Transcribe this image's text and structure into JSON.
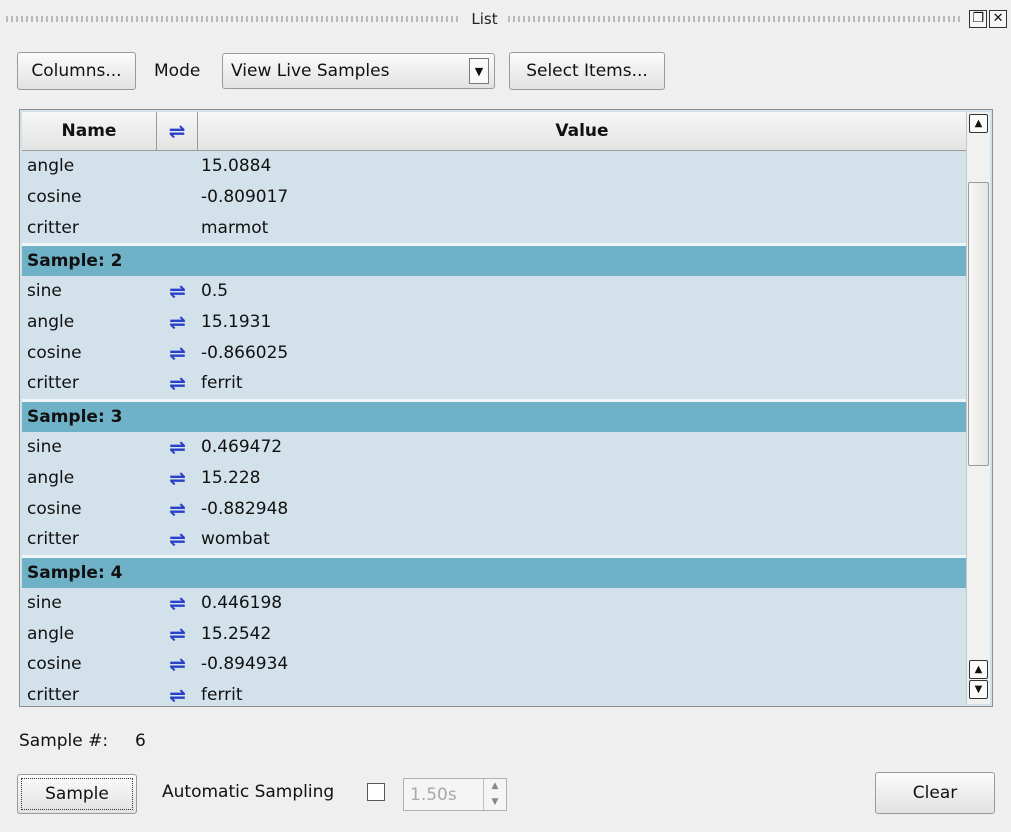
{
  "window": {
    "title": "List",
    "restore_icon": "restore-icon",
    "close_icon": "close-icon"
  },
  "toolbar": {
    "columns_label": "Columns...",
    "mode_label": "Mode",
    "mode_value": "View Live Samples",
    "select_items_label": "Select Items..."
  },
  "table": {
    "headers": {
      "name": "Name",
      "value": "Value",
      "link_icon": "⇌"
    },
    "top_rows": [
      {
        "name": "angle",
        "value": "15.0884"
      },
      {
        "name": "cosine",
        "value": "-0.809017"
      },
      {
        "name": "critter",
        "value": "marmot"
      }
    ],
    "groups": [
      {
        "title": "Sample: 2",
        "rows": [
          {
            "name": "sine",
            "value": "0.5"
          },
          {
            "name": "angle",
            "value": "15.1931"
          },
          {
            "name": "cosine",
            "value": "-0.866025"
          },
          {
            "name": "critter",
            "value": "ferrit"
          }
        ]
      },
      {
        "title": "Sample: 3",
        "rows": [
          {
            "name": "sine",
            "value": "0.469472"
          },
          {
            "name": "angle",
            "value": "15.228"
          },
          {
            "name": "cosine",
            "value": "-0.882948"
          },
          {
            "name": "critter",
            "value": "wombat"
          }
        ]
      },
      {
        "title": "Sample: 4",
        "rows": [
          {
            "name": "sine",
            "value": "0.446198"
          },
          {
            "name": "angle",
            "value": "15.2542"
          },
          {
            "name": "cosine",
            "value": "-0.894934"
          },
          {
            "name": "critter",
            "value": "ferrit"
          }
        ]
      }
    ],
    "row_icon": "⇌"
  },
  "footer": {
    "sample_count_label": "Sample #:",
    "sample_count_value": "6",
    "sample_button": "Sample",
    "auto_sampling_label": "Automatic Sampling",
    "auto_sampling_checked": false,
    "interval_value": "1.50s",
    "clear_button": "Clear"
  },
  "colors": {
    "row_bg": "#d2e1ea",
    "group_bg": "#6fb2c8",
    "icon": "#2940c8"
  }
}
